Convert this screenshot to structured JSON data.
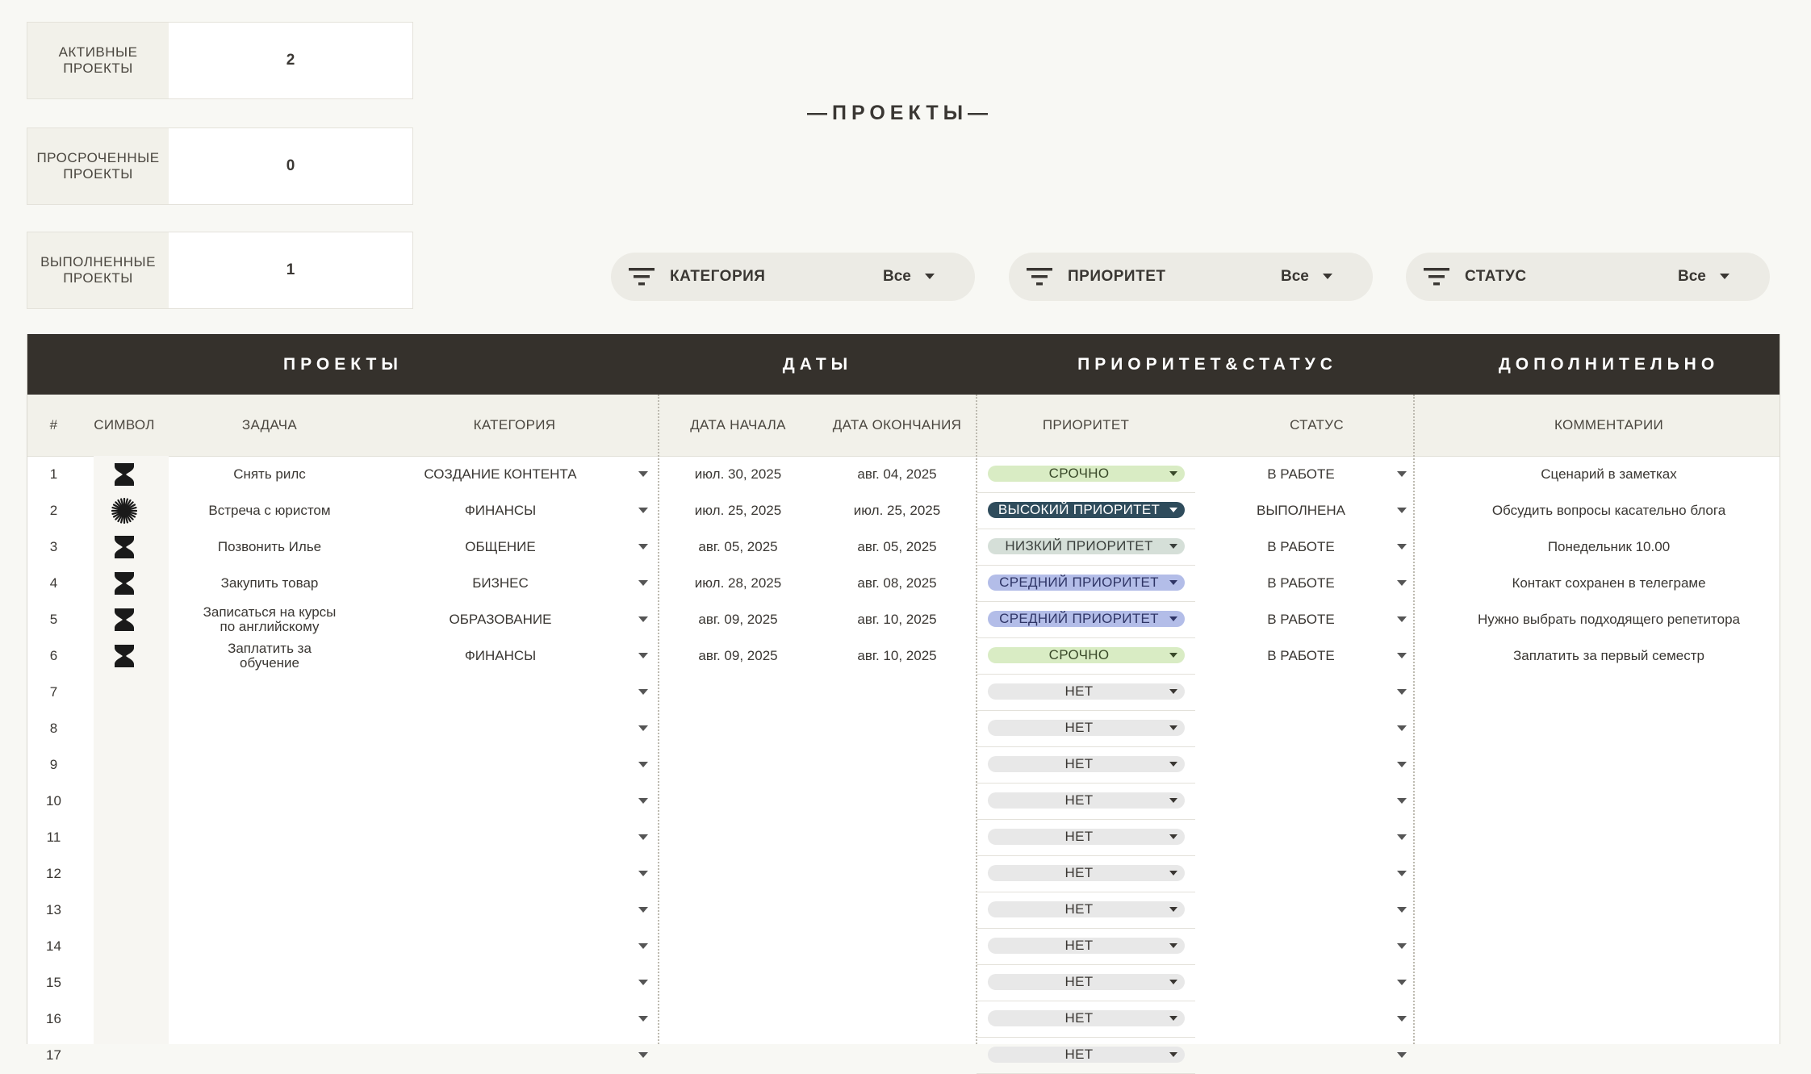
{
  "stats": [
    {
      "label": "АКТИВНЫЕ ПРОЕКТЫ",
      "value": "2"
    },
    {
      "label": "ПРОСРОЧЕННЫЕ ПРОЕКТЫ",
      "value": "0"
    },
    {
      "label": "ВЫПОЛНЕННЫЕ ПРОЕКТЫ",
      "value": "1"
    }
  ],
  "title": "—ПРОЕКТЫ—",
  "filters": [
    {
      "label": "КАТЕГОРИЯ",
      "value": "Все"
    },
    {
      "label": "ПРИОРИТЕТ",
      "value": "Все"
    },
    {
      "label": "СТАТУС",
      "value": "Все"
    }
  ],
  "sections": {
    "projects": "ПРОЕКТЫ",
    "dates": "ДАТЫ",
    "priority_status": "ПРИОРИТЕТ&СТАТУС",
    "extra": "ДОПОЛНИТЕЛЬНО"
  },
  "columns": {
    "num": "#",
    "symbol": "СИМВОЛ",
    "task": "ЗАДАЧА",
    "category": "КАТЕГОРИЯ",
    "start": "ДАТА НАЧАЛА",
    "end": "ДАТА ОКОНЧАНИЯ",
    "priority": "ПРИОРИТЕТ",
    "status": "СТАТУС",
    "comments": "КОММЕНТАРИИ"
  },
  "colors": {
    "header_band": "#35312c",
    "urgent": "#d9ecc4",
    "high": "#2f4c5c",
    "low": "#d5dfd8",
    "medium": "#b3bde8",
    "none": "#e8e8e8"
  },
  "rows": [
    {
      "num": "1",
      "symbol": "hourglass-icon",
      "task": "Снять рилс",
      "category": "СОЗДАНИЕ КОНТЕНТА",
      "start": "июл. 30, 2025",
      "end": "авг. 04, 2025",
      "priority": "СРОЧНО",
      "priority_level": "urgent",
      "status": "В РАБОТЕ",
      "comment": "Сценарий в заметках"
    },
    {
      "num": "2",
      "symbol": "starburst-icon",
      "task": "Встреча с юристом",
      "category": "ФИНАНСЫ",
      "start": "июл. 25, 2025",
      "end": "июл. 25, 2025",
      "priority": "ВЫСОКИЙ ПРИОРИТЕТ",
      "priority_level": "high",
      "status": "ВЫПОЛНЕНА",
      "comment": "Обсудить вопросы касательно блога"
    },
    {
      "num": "3",
      "symbol": "hourglass-icon",
      "task": "Позвонить Илье",
      "category": "ОБЩЕНИЕ",
      "start": "авг. 05, 2025",
      "end": "авг. 05, 2025",
      "priority": "НИЗКИЙ ПРИОРИТЕТ",
      "priority_level": "low",
      "status": "В РАБОТЕ",
      "comment": "Понедельник 10.00"
    },
    {
      "num": "4",
      "symbol": "hourglass-icon",
      "task": "Закупить товар",
      "category": "БИЗНЕС",
      "start": "июл. 28, 2025",
      "end": "авг. 08, 2025",
      "priority": "СРЕДНИЙ ПРИОРИТЕТ",
      "priority_level": "medium",
      "status": "В РАБОТЕ",
      "comment": "Контакт сохранен в телеграме"
    },
    {
      "num": "5",
      "symbol": "hourglass-icon",
      "task": "Записаться на курсы по английскому",
      "category": "ОБРАЗОВАНИЕ",
      "start": "авг. 09, 2025",
      "end": "авг. 10, 2025",
      "priority": "СРЕДНИЙ ПРИОРИТЕТ",
      "priority_level": "medium",
      "status": "В РАБОТЕ",
      "comment": "Нужно выбрать подходящего репетитора"
    },
    {
      "num": "6",
      "symbol": "hourglass-icon",
      "task": "Заплатить за обучение",
      "category": "ФИНАНСЫ",
      "start": "авг. 09, 2025",
      "end": "авг. 10, 2025",
      "priority": "СРОЧНО",
      "priority_level": "urgent",
      "status": "В РАБОТЕ",
      "comment": "Заплатить за первый семестр"
    },
    {
      "num": "7",
      "symbol": "",
      "task": "",
      "category": "",
      "start": "",
      "end": "",
      "priority": "НЕТ",
      "priority_level": "none",
      "status": "",
      "comment": ""
    },
    {
      "num": "8",
      "symbol": "",
      "task": "",
      "category": "",
      "start": "",
      "end": "",
      "priority": "НЕТ",
      "priority_level": "none",
      "status": "",
      "comment": ""
    },
    {
      "num": "9",
      "symbol": "",
      "task": "",
      "category": "",
      "start": "",
      "end": "",
      "priority": "НЕТ",
      "priority_level": "none",
      "status": "",
      "comment": ""
    },
    {
      "num": "10",
      "symbol": "",
      "task": "",
      "category": "",
      "start": "",
      "end": "",
      "priority": "НЕТ",
      "priority_level": "none",
      "status": "",
      "comment": ""
    },
    {
      "num": "11",
      "symbol": "",
      "task": "",
      "category": "",
      "start": "",
      "end": "",
      "priority": "НЕТ",
      "priority_level": "none",
      "status": "",
      "comment": ""
    },
    {
      "num": "12",
      "symbol": "",
      "task": "",
      "category": "",
      "start": "",
      "end": "",
      "priority": "НЕТ",
      "priority_level": "none",
      "status": "",
      "comment": ""
    },
    {
      "num": "13",
      "symbol": "",
      "task": "",
      "category": "",
      "start": "",
      "end": "",
      "priority": "НЕТ",
      "priority_level": "none",
      "status": "",
      "comment": ""
    },
    {
      "num": "14",
      "symbol": "",
      "task": "",
      "category": "",
      "start": "",
      "end": "",
      "priority": "НЕТ",
      "priority_level": "none",
      "status": "",
      "comment": ""
    },
    {
      "num": "15",
      "symbol": "",
      "task": "",
      "category": "",
      "start": "",
      "end": "",
      "priority": "НЕТ",
      "priority_level": "none",
      "status": "",
      "comment": ""
    },
    {
      "num": "16",
      "symbol": "",
      "task": "",
      "category": "",
      "start": "",
      "end": "",
      "priority": "НЕТ",
      "priority_level": "none",
      "status": "",
      "comment": ""
    },
    {
      "num": "17",
      "symbol": "",
      "task": "",
      "category": "",
      "start": "",
      "end": "",
      "priority": "НЕТ",
      "priority_level": "none",
      "status": "",
      "comment": ""
    }
  ]
}
